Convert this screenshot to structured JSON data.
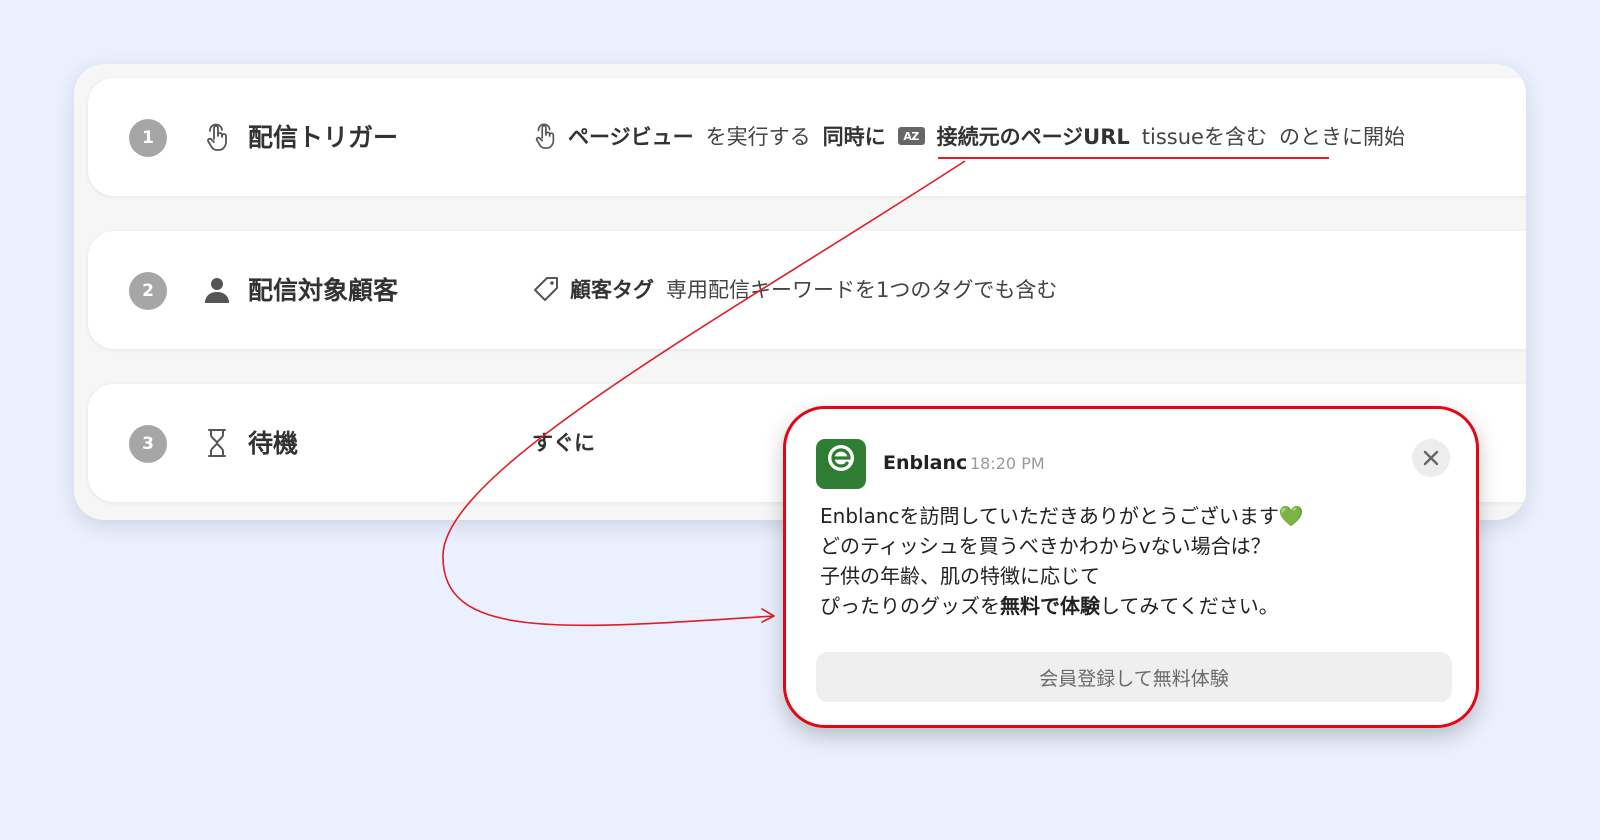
{
  "steps": [
    {
      "number": "1",
      "icon": "tap-hand-icon",
      "title": "配信トリガー",
      "desc": {
        "event_icon": "tap-hand-icon",
        "event": "ページビュー",
        "event_suffix": "を実行する",
        "joiner": "同時に",
        "cond_icon": "az-text-icon",
        "cond_icon_text": "AZ",
        "cond_field": "接続元のページURL",
        "cond_value": "tissueを含む",
        "suffix": "のときに開始"
      }
    },
    {
      "number": "2",
      "icon": "person-icon",
      "title": "配信対象顧客",
      "desc": {
        "icon": "tag-icon",
        "label": "顧客タグ",
        "value": "専用配信キーワードを1つのタグでも含む"
      }
    },
    {
      "number": "3",
      "icon": "hourglass-icon",
      "title": "待機",
      "desc": {
        "value": "すぐに"
      }
    }
  ],
  "notification": {
    "app_logo_icon": "enblanc-logo-icon",
    "logo_text": "enblanc",
    "app_name": "Enblanc",
    "time": "18:20 PM",
    "message": {
      "line1": "Enblancを訪問していただきありがとうございます💚",
      "line2": "どのティッシュを買うべきかわからvない場合は？",
      "line3": "子供の年齢、肌の特徴に応じて",
      "line4_a": "ぴったりのグッズを",
      "line4_bold": "無料で体験",
      "line4_b": "してみてください。"
    },
    "cta_label": "会員登録して無料体験",
    "close_icon": "close-icon"
  },
  "colors": {
    "background": "#eaf0fd",
    "accent_red": "#e30613",
    "brand_green": "#2f7d32",
    "step_badge": "#a6a6a6"
  }
}
